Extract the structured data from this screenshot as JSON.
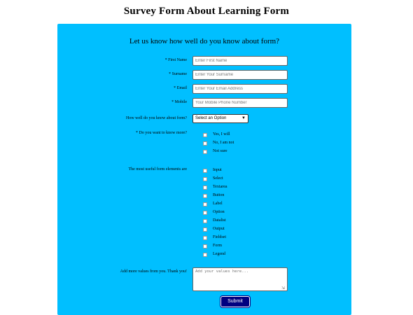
{
  "page": {
    "title": "Survey Form About Learning Form"
  },
  "form": {
    "heading": "Let us know how well do you know about form?",
    "fields": {
      "first_name": {
        "label": "* First Name",
        "placeholder": "Enter First Name"
      },
      "surname": {
        "label": "* Surname",
        "placeholder": "Enter Your Surname"
      },
      "email": {
        "label": "* Email",
        "placeholder": "Enter Your Email Address"
      },
      "mobile": {
        "label": "* Mobile",
        "placeholder": "Your Mobile Phone Number"
      }
    },
    "knowledge": {
      "label": "How well do you know about form?",
      "selected": "Select an Option"
    },
    "want_more": {
      "label": "* Do you want to know more?",
      "options": [
        "Yes, I will",
        "No, I am not",
        "Not sure"
      ]
    },
    "elements": {
      "label": "The most useful form elements are",
      "options": [
        "Input",
        "Select",
        "Textarea",
        "Button",
        "Label",
        "Option",
        "Datalist",
        "Output",
        "Fieldset",
        "Form",
        "Legend"
      ]
    },
    "comments": {
      "label": "Add more values from you. Thank you!",
      "placeholder": "Add your values here..."
    },
    "submit_label": "Submit"
  }
}
